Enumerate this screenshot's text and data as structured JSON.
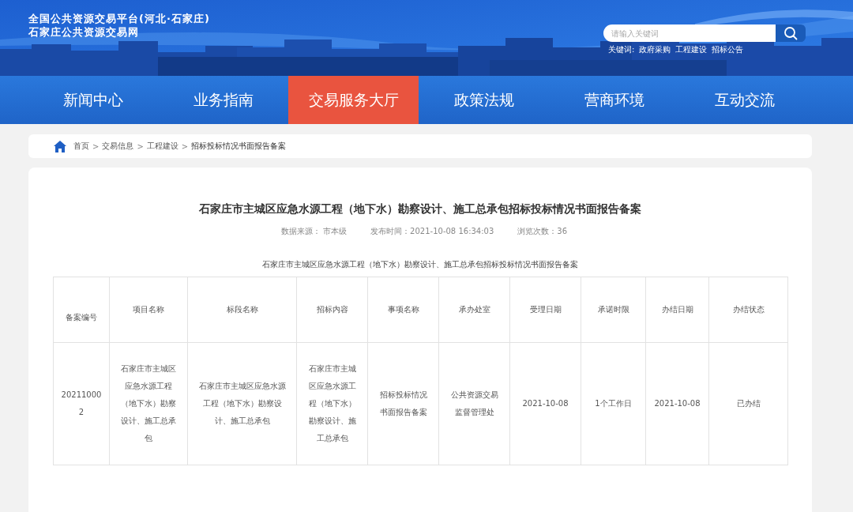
{
  "header": {
    "title_lines": [
      "全国公共资源交易平台(河北·石家庄)",
      "石家庄公共资源交易网"
    ],
    "search": {
      "placeholder": "请输入关键词"
    },
    "keywords_label": "关键词:",
    "keywords": [
      "政府采购",
      "工程建设",
      "招标公告"
    ]
  },
  "nav": [
    {
      "label": "新闻中心",
      "selected": false
    },
    {
      "label": "业务指南",
      "selected": false
    },
    {
      "label": "交易服务大厅",
      "selected": true
    },
    {
      "label": "政策法规",
      "selected": false
    },
    {
      "label": "营商环境",
      "selected": false
    },
    {
      "label": "互动交流",
      "selected": false
    }
  ],
  "breadcrumb": [
    {
      "kind": "link",
      "text": "首页"
    },
    {
      "kind": "separator",
      "text": ">"
    },
    {
      "kind": "link",
      "text": "交易信息"
    },
    {
      "kind": "separator",
      "text": ">"
    },
    {
      "kind": "link",
      "text": "工程建设"
    },
    {
      "kind": "separator",
      "text": ">"
    },
    {
      "kind": "current",
      "text": "招标投标情况书面报告备案"
    }
  ],
  "article": {
    "title": "石家庄市主城区应急水源工程（地下水）勘察设计、施工总承包招标投标情况书面报告备案",
    "meta": [
      "数据来源：  市本级",
      "发布时间：2021-10-08 16:34:03",
      "浏览次数：36"
    ],
    "table_caption": "石家庄市主城区应急水源工程（地下水）勘察设计、施工总承包招标投标情况书面报告备案"
  },
  "table": {
    "columns": [
      "备案编号",
      "项目名称",
      "标段名称",
      "招标内容",
      "事项名称",
      "承办处室",
      "受理日期",
      "承诺时限",
      "办结日期",
      "办结状态"
    ],
    "rows": [
      [
        "202110002",
        "石家庄市主城区应急水源工程（地下水）勘察设计、施工总承包",
        "石家庄市主城区应急水源工程（地下水）勘察设计、施工总承包",
        "石家庄市主城区应急水源工程（地下水）勘察设计、施工总承包",
        "招标投标情况书面报告备案",
        "公共资源交易监督管理处",
        "2021-10-08",
        "1个工作日",
        "2021-10-08",
        "已办结"
      ]
    ]
  }
}
